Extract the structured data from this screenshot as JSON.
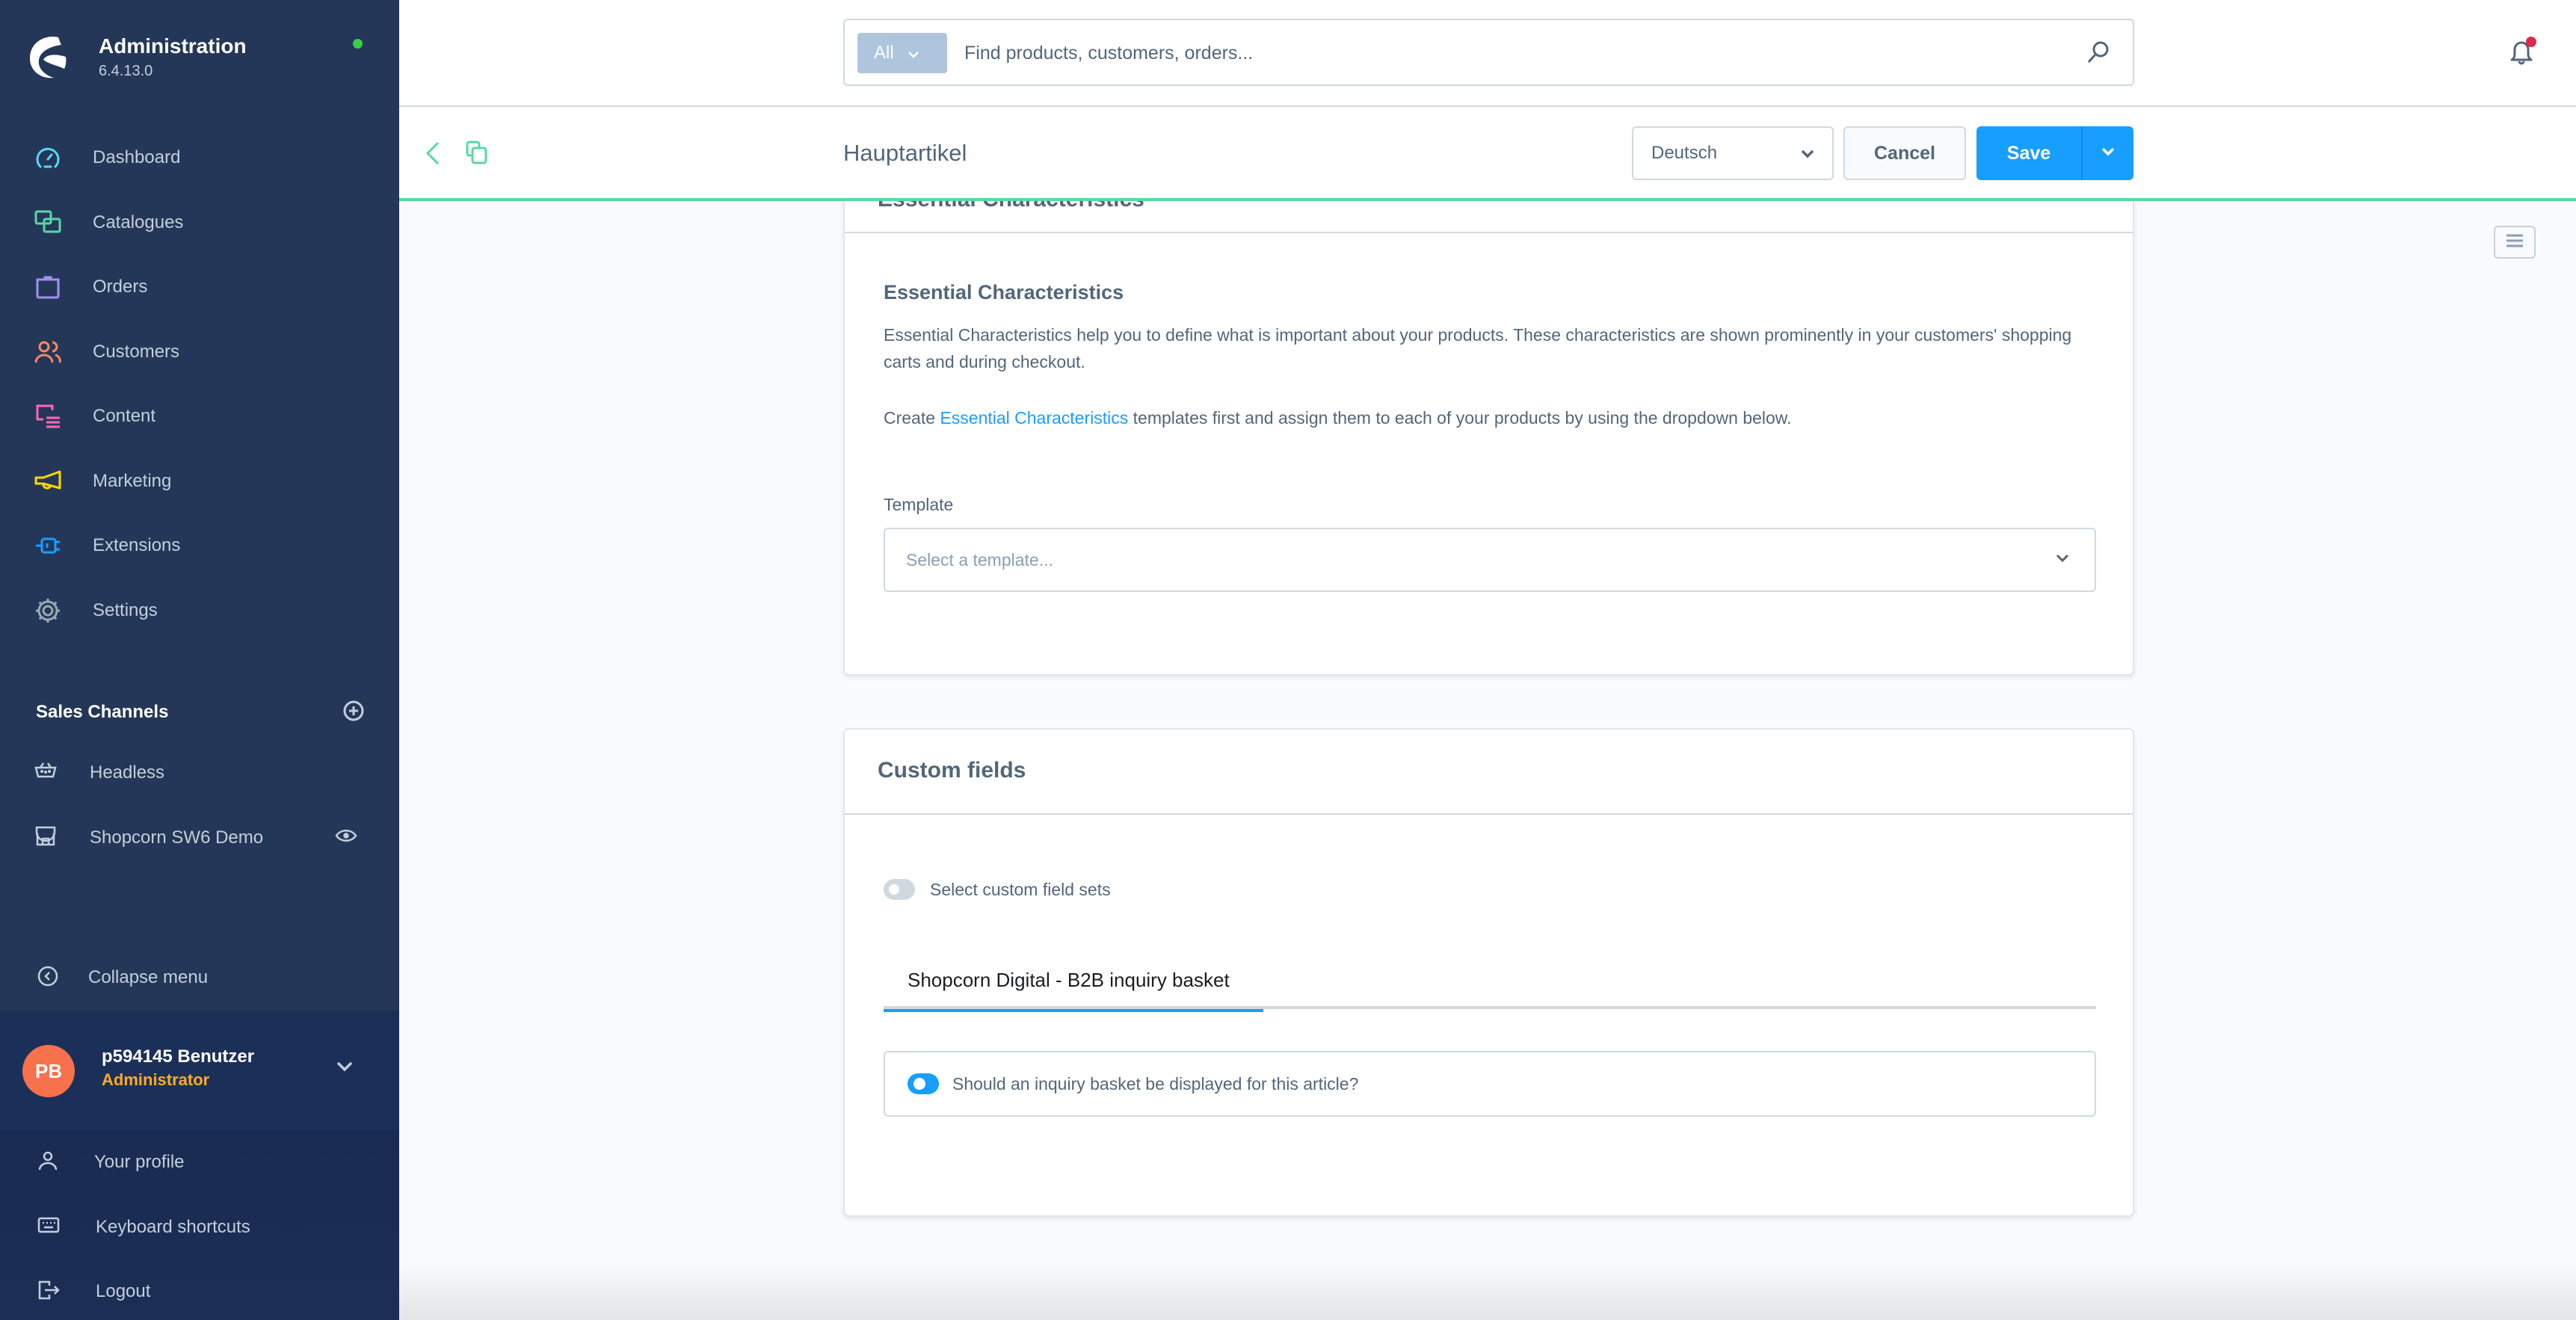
{
  "app": {
    "title": "Administration",
    "version": "6.4.13.0",
    "status_color": "#37d046"
  },
  "sidebar": {
    "nav_items": [
      {
        "label": "Dashboard",
        "icon": "dashboard-icon",
        "color": "#57d9f9"
      },
      {
        "label": "Catalogues",
        "icon": "catalogues-icon",
        "color": "#57d9a3"
      },
      {
        "label": "Orders",
        "icon": "orders-icon",
        "color": "#a092f0"
      },
      {
        "label": "Customers",
        "icon": "customers-icon",
        "color": "#f88962"
      },
      {
        "label": "Content",
        "icon": "content-icon",
        "color": "#ff68b4"
      },
      {
        "label": "Marketing",
        "icon": "marketing-icon",
        "color": "#ffd700"
      },
      {
        "label": "Extensions",
        "icon": "extensions-icon",
        "color": "#189eff"
      },
      {
        "label": "Settings",
        "icon": "settings-icon",
        "color": "#9aa8b5"
      }
    ],
    "sales_channels": {
      "title": "Sales Channels",
      "items": [
        {
          "label": "Headless",
          "icon": "basket-icon"
        },
        {
          "label": "Shopcorn SW6 Demo",
          "icon": "storefront-icon",
          "action_icon": "eye-icon"
        }
      ]
    },
    "collapse_label": "Collapse menu",
    "user": {
      "initials": "PB",
      "name": "p594145 Benutzer",
      "role": "Administrator"
    },
    "profile_menu": [
      {
        "label": "Your profile",
        "icon": "user-icon"
      },
      {
        "label": "Keyboard shortcuts",
        "icon": "keyboard-icon"
      },
      {
        "label": "Logout",
        "icon": "logout-icon"
      }
    ]
  },
  "topbar": {
    "search_type": "All",
    "search_placeholder": "Find products, customers, orders...",
    "notification_badge_color": "#de294c"
  },
  "smartbar": {
    "title": "Hauptartikel",
    "language": "Deutsch",
    "cancel_label": "Cancel",
    "save_label": "Save"
  },
  "essential_characteristics": {
    "card_title": "Essential Characteristics",
    "heading": "Essential Characteristics",
    "description": "Essential Characteristics help you to define what is important about your products. These characteristics are shown prominently in your customers' shopping carts and during checkout.",
    "create_prefix": "Create ",
    "create_link": "Essential Characteristics",
    "create_suffix": " templates first and assign them to each of your products by using the dropdown below.",
    "template_label": "Template",
    "template_placeholder": "Select a template..."
  },
  "custom_fields": {
    "card_title": "Custom fields",
    "select_sets_label": "Select custom field sets",
    "select_sets_enabled": false,
    "tabs": [
      {
        "label": "Shopcorn Digital - B2B inquiry basket",
        "active": true
      }
    ],
    "fields": [
      {
        "label": "Should an inquiry basket be displayed for this article?",
        "enabled": true
      }
    ]
  },
  "colors": {
    "primary": "#189eff",
    "accent_green": "#57d9a3",
    "sidebar_bg": "#243758",
    "avatar": "#f7714c",
    "role": "#ffab23"
  }
}
